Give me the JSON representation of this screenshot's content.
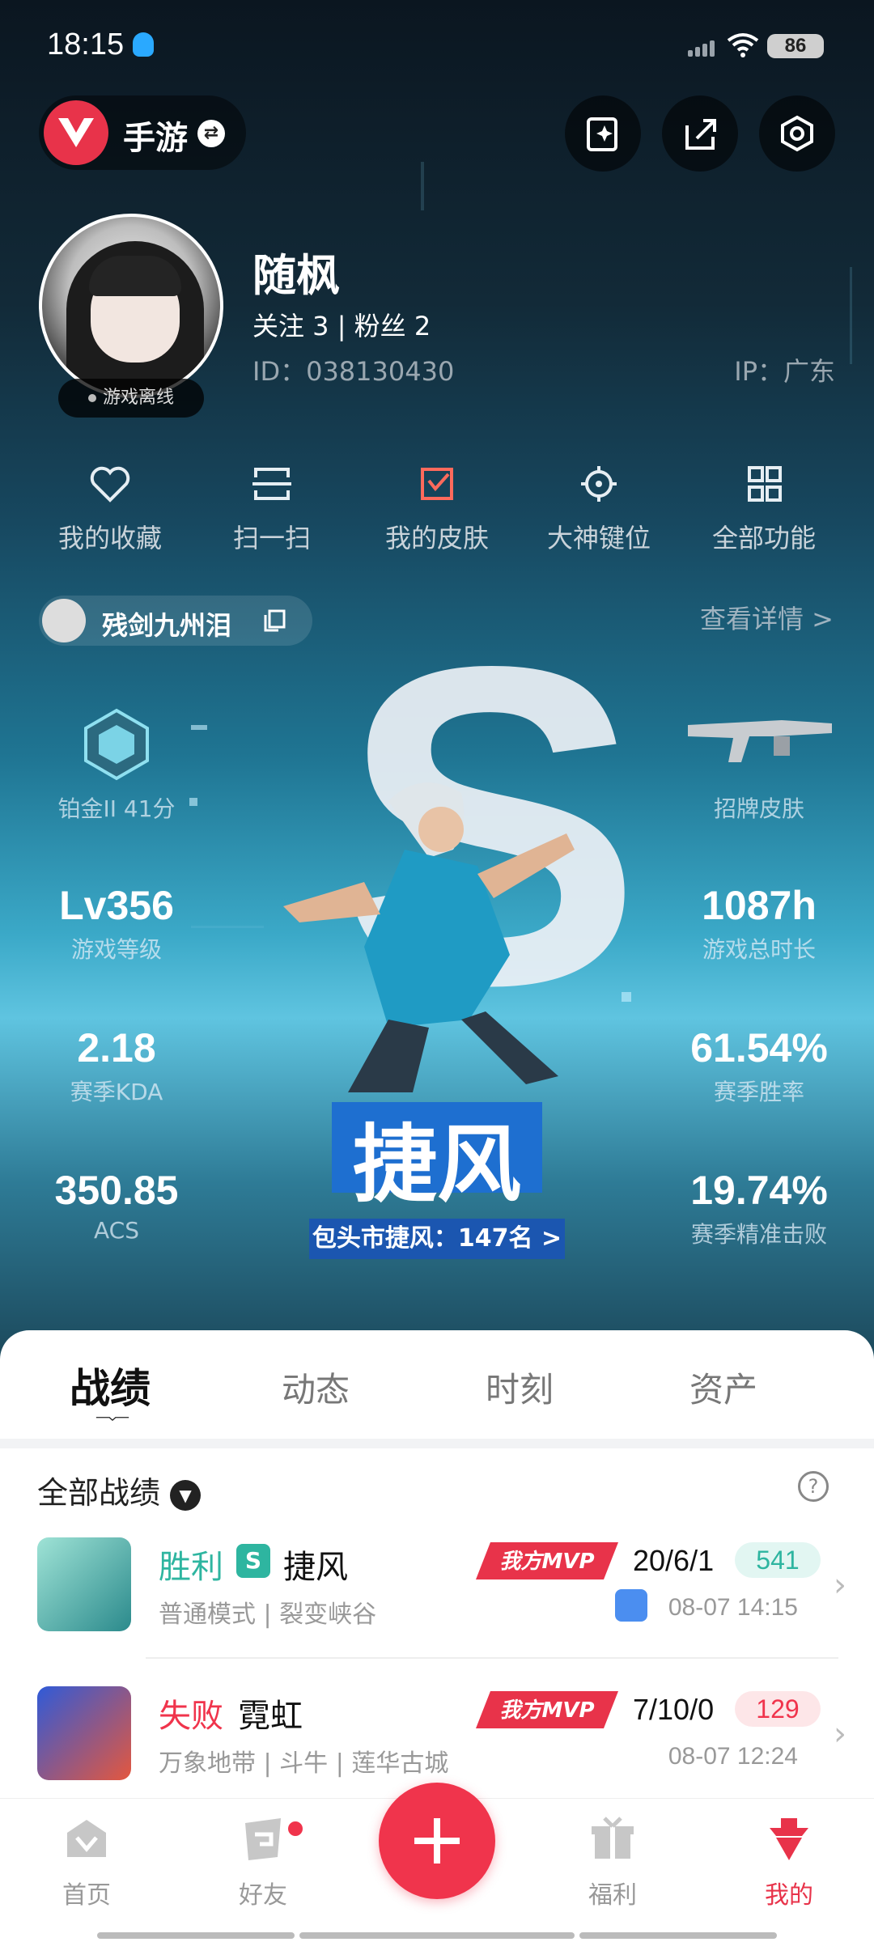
{
  "status_bar": {
    "time": "18:15",
    "battery": "86"
  },
  "topbar": {
    "game_label": "手游"
  },
  "profile": {
    "username": "随枫",
    "follow_text": "关注 3  |  粉丝 2",
    "id_text": "ID：038130430",
    "ip_text": "IP：广东",
    "status": "游戏离线"
  },
  "actions": [
    {
      "label": "我的收藏",
      "icon": "heart-icon"
    },
    {
      "label": "扫一扫",
      "icon": "scan-icon"
    },
    {
      "label": "我的皮肤",
      "icon": "skin-icon"
    },
    {
      "label": "大神键位",
      "icon": "crosshair-icon"
    },
    {
      "label": "全部功能",
      "icon": "grid-icon"
    }
  ],
  "account": {
    "name": "残剑九州泪",
    "detail_link": "查看详情 >"
  },
  "stats": {
    "rank": "铂金II 41分",
    "skin": "招牌皮肤",
    "level_value": "Lv356",
    "level_label": "游戏等级",
    "hours_value": "1087h",
    "hours_label": "游戏总时长",
    "kda_value": "2.18",
    "kda_label": "赛季KDA",
    "winrate_value": "61.54%",
    "winrate_label": "赛季胜率",
    "acs_value": "350.85",
    "acs_label": "ACS",
    "hs_value": "19.74%",
    "hs_label": "赛季精准击败"
  },
  "hero": {
    "agent_name": "捷风",
    "rank_text": "包头市捷风：147名 >"
  },
  "tabs": [
    "战绩",
    "动态",
    "时刻",
    "资产"
  ],
  "filter": {
    "label": "全部战绩",
    "help": "?"
  },
  "matches": [
    {
      "result": "胜利",
      "result_color": "#2eb5a0",
      "badge": "S",
      "agent": "捷风",
      "mode": "普通模式 | 裂变峡谷",
      "kda": "20/6/1",
      "score": "541",
      "score_bg": "#e2f6f2",
      "score_color": "#2eb5a0",
      "time": "08-07 14:15",
      "mvp": "我方MVP"
    },
    {
      "result": "失败",
      "result_color": "#f0344c",
      "agent": "霓虹",
      "mode": "万象地带 | 斗牛 | 莲华古城",
      "kda": "7/10/0",
      "score": "129",
      "score_bg": "#fde6e8",
      "score_color": "#f0344c",
      "time": "08-07 12:24",
      "mvp": "我方MVP"
    }
  ],
  "nav": [
    {
      "label": "首页",
      "icon": "home-icon"
    },
    {
      "label": "好友",
      "icon": "friends-icon"
    },
    {
      "label": "福利",
      "icon": "gift-icon"
    },
    {
      "label": "我的",
      "icon": "profile-icon"
    }
  ],
  "colors": {
    "accent": "#f0344c",
    "win": "#2eb5a0",
    "lose": "#f0344c"
  }
}
